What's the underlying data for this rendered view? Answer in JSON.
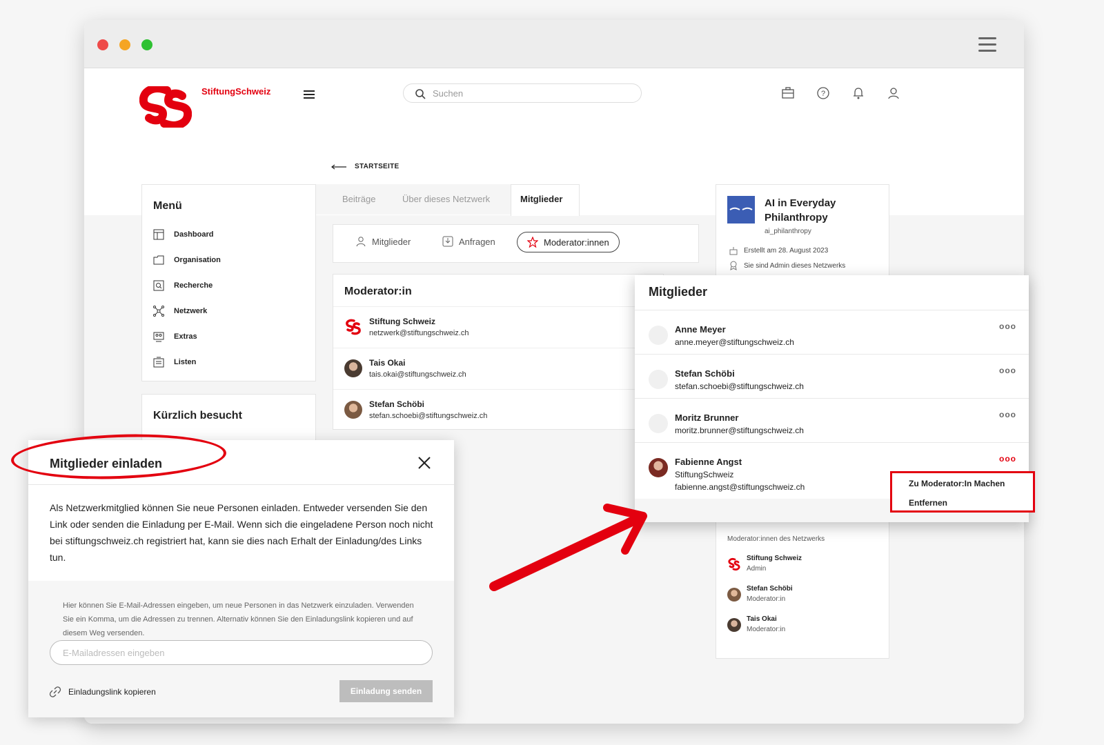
{
  "app": {
    "brand": "StiftungSchweiz"
  },
  "search": {
    "placeholder": "Suchen"
  },
  "nav": {
    "back_label": "STARTSEITE"
  },
  "menu": {
    "title": "Menü",
    "items": [
      {
        "label": "Dashboard",
        "icon": "dashboard-icon"
      },
      {
        "label": "Organisation",
        "icon": "folder-icon"
      },
      {
        "label": "Recherche",
        "icon": "search-icon"
      },
      {
        "label": "Netzwerk",
        "icon": "network-icon"
      },
      {
        "label": "Extras",
        "icon": "extras-icon"
      },
      {
        "label": "Listen",
        "icon": "list-icon"
      }
    ]
  },
  "recent": {
    "title": "Kürzlich besucht"
  },
  "tabs": [
    {
      "label": "Beiträge",
      "active": false
    },
    {
      "label": "Über dieses Netzwerk",
      "active": false
    },
    {
      "label": "Mitglieder",
      "active": true
    }
  ],
  "filters": [
    {
      "label": "Mitglieder",
      "icon": "user-icon"
    },
    {
      "label": "Anfragen",
      "icon": "inbox-icon"
    },
    {
      "label": "Moderator:innen",
      "icon": "star-icon",
      "selected": true
    }
  ],
  "moderators": {
    "title": "Moderator:in",
    "rows": [
      {
        "name": "Stiftung Schweiz",
        "email": "netzwerk@stiftungschweiz.ch"
      },
      {
        "name": "Tais Okai",
        "email": "tais.okai@stiftungschweiz.ch"
      },
      {
        "name": "Stefan Schöbi",
        "email": "stefan.schoebi@stiftungschweiz.ch"
      }
    ]
  },
  "network": {
    "title": "AI in Everyday Philanthropy",
    "handle": "ai_philanthropy",
    "created": "Erstellt am 28. August 2023",
    "admin_note": "Sie sind Admin dieses Netzwerks",
    "mods_title": "Moderator:innen des Netzwerks",
    "mods": [
      {
        "name": "Stiftung Schweiz",
        "role": "Admin"
      },
      {
        "name": "Stefan Schöbi",
        "role": "Moderator:in"
      },
      {
        "name": "Tais Okai",
        "role": "Moderator:in"
      }
    ]
  },
  "members_panel": {
    "title": "Mitglieder",
    "rows": [
      {
        "name": "Anne Meyer",
        "line1": "anne.meyer@stiftungschweiz.ch",
        "line2": ""
      },
      {
        "name": "Stefan Schöbi",
        "line1": "stefan.schoebi@stiftungschweiz.ch",
        "line2": ""
      },
      {
        "name": "Moritz Brunner",
        "line1": "moritz.brunner@stiftungschweiz.ch",
        "line2": ""
      },
      {
        "name": "Fabienne Angst",
        "line1": "StiftungSchweiz",
        "line2": "fabienne.angst@stiftungschweiz.ch"
      }
    ],
    "more_label": "ooo",
    "context_menu": [
      "Zu Moderator:In Machen",
      "Entfernen"
    ]
  },
  "invite": {
    "title": "Mitglieder einladen",
    "description": "Als Netzwerkmitglied können Sie neue Personen einladen. Entweder versenden Sie den Link oder senden die Einladung per E-Mail. Wenn sich die eingeladene Person noch nicht bei stiftungschweiz.ch registriert hat, kann sie dies nach Erhalt der Einladung/des Links tun.",
    "hint": "Hier können Sie E-Mail-Adressen eingeben, um neue Personen in das Netzwerk einzuladen. Verwenden Sie ein Komma, um die Adressen zu trennen. Alternativ können Sie den Einladungslink kopieren und auf diesem Weg versenden.",
    "email_placeholder": "E-Mailadressen eingeben",
    "copy_link": "Einladungslink kopieren",
    "send": "Einladung senden"
  },
  "colors": {
    "brand": "#e3000f",
    "network_logo": "#3b5db4",
    "disabled_button": "#bdbdbd"
  }
}
